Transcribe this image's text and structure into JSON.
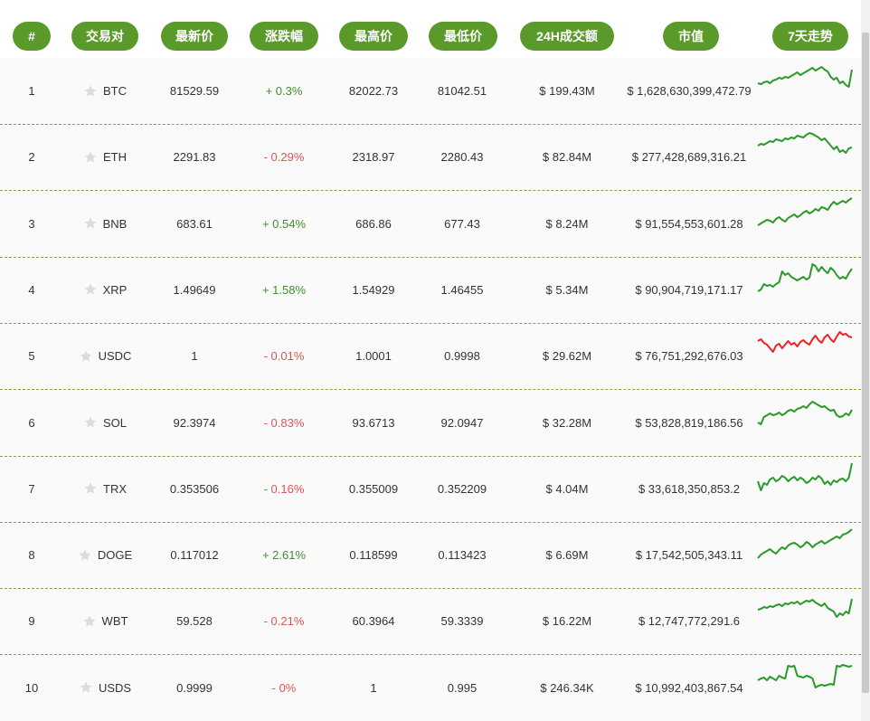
{
  "headers": {
    "rank": "#",
    "pair": "交易对",
    "price": "最新价",
    "change": "涨跌幅",
    "high": "最高价",
    "low": "最低价",
    "volume": "24H成交额",
    "market_cap": "市值",
    "trend": "7天走势"
  },
  "colors": {
    "accent": "#5a9a2a",
    "up": "#3f8f2a",
    "down": "#e25555",
    "spark_green": "#2a9a2a",
    "spark_red": "#ee2222"
  },
  "rows": [
    {
      "rank": "1",
      "symbol": "BTC",
      "price": "81529.59",
      "change": "+ 0.3%",
      "dir": "up",
      "high": "82022.73",
      "low": "81042.51",
      "volume": "$ 199.43M",
      "market_cap": "$ 1,628,630,399,472.79",
      "trend_color": "green",
      "trend": [
        40,
        39,
        41,
        42,
        40,
        43,
        44,
        46,
        45,
        47,
        46,
        48,
        50,
        52,
        49,
        51,
        53,
        55,
        57,
        54,
        56,
        58,
        55,
        53,
        47,
        44,
        46,
        40,
        42,
        38,
        36,
        55
      ]
    },
    {
      "rank": "2",
      "symbol": "ETH",
      "price": "2291.83",
      "change": "- 0.29%",
      "dir": "down",
      "high": "2318.97",
      "low": "2280.43",
      "volume": "$ 82.84M",
      "market_cap": "$ 277,428,689,316.21",
      "trend_color": "green",
      "trend": [
        44,
        46,
        45,
        47,
        49,
        48,
        51,
        50,
        49,
        52,
        51,
        53,
        52,
        55,
        54,
        53,
        56,
        58,
        57,
        55,
        53,
        50,
        52,
        48,
        44,
        40,
        43,
        37,
        39,
        36,
        41,
        42
      ]
    },
    {
      "rank": "3",
      "symbol": "BNB",
      "price": "683.61",
      "change": "+ 0.54%",
      "dir": "up",
      "high": "686.86",
      "low": "677.43",
      "volume": "$ 8.24M",
      "market_cap": "$ 91,554,553,601.28",
      "trend_color": "green",
      "trend": [
        30,
        32,
        34,
        36,
        35,
        33,
        37,
        39,
        36,
        34,
        38,
        40,
        42,
        39,
        41,
        44,
        46,
        43,
        45,
        48,
        46,
        50,
        49,
        47,
        52,
        56,
        53,
        55,
        57,
        55,
        58,
        60
      ]
    },
    {
      "rank": "4",
      "symbol": "XRP",
      "price": "1.49649",
      "change": "+ 1.58%",
      "dir": "up",
      "high": "1.54929",
      "low": "1.46455",
      "volume": "$ 5.34M",
      "market_cap": "$ 90,904,719,171.17",
      "trend_color": "green",
      "trend": [
        30,
        32,
        38,
        36,
        37,
        35,
        38,
        40,
        52,
        48,
        50,
        46,
        44,
        42,
        44,
        46,
        43,
        45,
        60,
        58,
        52,
        57,
        53,
        50,
        56,
        53,
        48,
        44,
        46,
        44,
        50,
        55
      ]
    },
    {
      "rank": "5",
      "symbol": "USDC",
      "price": "1",
      "change": "- 0.01%",
      "dir": "down",
      "high": "1.0001",
      "low": "0.9998",
      "volume": "$ 29.62M",
      "market_cap": "$ 76,751,292,676.03",
      "trend_color": "red",
      "trend": [
        48,
        50,
        46,
        44,
        40,
        36,
        43,
        45,
        40,
        44,
        48,
        44,
        46,
        42,
        47,
        49,
        46,
        44,
        50,
        54,
        49,
        46,
        52,
        55,
        50,
        47,
        53,
        58,
        55,
        56,
        53,
        52
      ]
    },
    {
      "rank": "6",
      "symbol": "SOL",
      "price": "92.3974",
      "change": "- 0.83%",
      "dir": "down",
      "high": "93.6713",
      "low": "92.0947",
      "volume": "$ 32.28M",
      "market_cap": "$ 53,828,819,186.56",
      "trend_color": "green",
      "trend": [
        32,
        30,
        38,
        40,
        42,
        40,
        41,
        43,
        40,
        42,
        45,
        46,
        44,
        47,
        48,
        50,
        48,
        52,
        55,
        53,
        51,
        49,
        50,
        47,
        45,
        46,
        40,
        38,
        39,
        42,
        40,
        46
      ]
    },
    {
      "rank": "7",
      "symbol": "TRX",
      "price": "0.353506",
      "change": "- 0.16%",
      "dir": "down",
      "high": "0.355009",
      "low": "0.352209",
      "volume": "$ 4.04M",
      "market_cap": "$ 33,618,350,853.2",
      "trend_color": "green",
      "trend": [
        40,
        30,
        38,
        36,
        42,
        44,
        40,
        42,
        46,
        44,
        40,
        43,
        45,
        41,
        44,
        42,
        38,
        40,
        44,
        42,
        46,
        43,
        37,
        40,
        36,
        41,
        39,
        42,
        43,
        40,
        44,
        60
      ]
    },
    {
      "rank": "8",
      "symbol": "DOGE",
      "price": "0.117012",
      "change": "+ 2.61%",
      "dir": "up",
      "high": "0.118599",
      "low": "0.113423",
      "volume": "$ 6.69M",
      "market_cap": "$ 17,542,505,343.11",
      "trend_color": "green",
      "trend": [
        28,
        32,
        34,
        36,
        38,
        35,
        33,
        37,
        40,
        38,
        42,
        44,
        45,
        43,
        40,
        42,
        46,
        44,
        40,
        43,
        45,
        47,
        44,
        46,
        48,
        50,
        52,
        50,
        54,
        55,
        57,
        60
      ]
    },
    {
      "rank": "9",
      "symbol": "WBT",
      "price": "59.528",
      "change": "- 0.21%",
      "dir": "down",
      "high": "60.3964",
      "low": "59.3339",
      "volume": "$ 16.22M",
      "market_cap": "$ 12,747,772,291.6",
      "trend_color": "green",
      "trend": [
        44,
        45,
        47,
        46,
        48,
        47,
        49,
        50,
        48,
        51,
        50,
        52,
        51,
        53,
        50,
        52,
        54,
        53,
        55,
        52,
        50,
        48,
        51,
        46,
        44,
        42,
        36,
        40,
        38,
        42,
        40,
        56
      ]
    },
    {
      "rank": "10",
      "symbol": "USDS",
      "price": "0.9999",
      "change": "- 0%",
      "dir": "down",
      "high": "1",
      "low": "0.995",
      "volume": "$ 246.34K",
      "market_cap": "$ 10,992,403,867.54",
      "trend_color": "green",
      "trend": [
        40,
        42,
        43,
        40,
        44,
        42,
        40,
        45,
        43,
        42,
        56,
        55,
        56,
        45,
        44,
        43,
        45,
        44,
        42,
        32,
        34,
        35,
        34,
        35,
        36,
        35,
        56,
        55,
        57,
        56,
        55,
        56
      ]
    }
  ]
}
